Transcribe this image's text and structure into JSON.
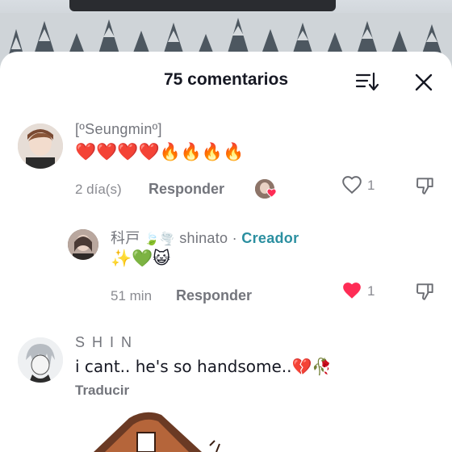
{
  "header": {
    "title": "75 comentarios"
  },
  "comments": [
    {
      "username": "[ºSeungminº]",
      "text": "❤️❤️❤️❤️🔥🔥🔥🔥",
      "time": "2 día(s)",
      "reply_label": "Responder",
      "likes": "1",
      "liked": false,
      "replies": [
        {
          "username_prefix": "科戸",
          "username": "shinato",
          "separator": " · ",
          "badge": "Creador",
          "text": "✨💚😺",
          "time": "51 min",
          "reply_label": "Responder",
          "likes": "1",
          "liked": true
        }
      ]
    },
    {
      "username": "S H I N",
      "text": "i cant.. he's so handsome..💔🥀",
      "translate_label": "Traducir"
    }
  ],
  "colors": {
    "accent_like": "#fe2c55",
    "creator": "#2b8fa0",
    "text": "#161823",
    "muted": "#73757c"
  }
}
